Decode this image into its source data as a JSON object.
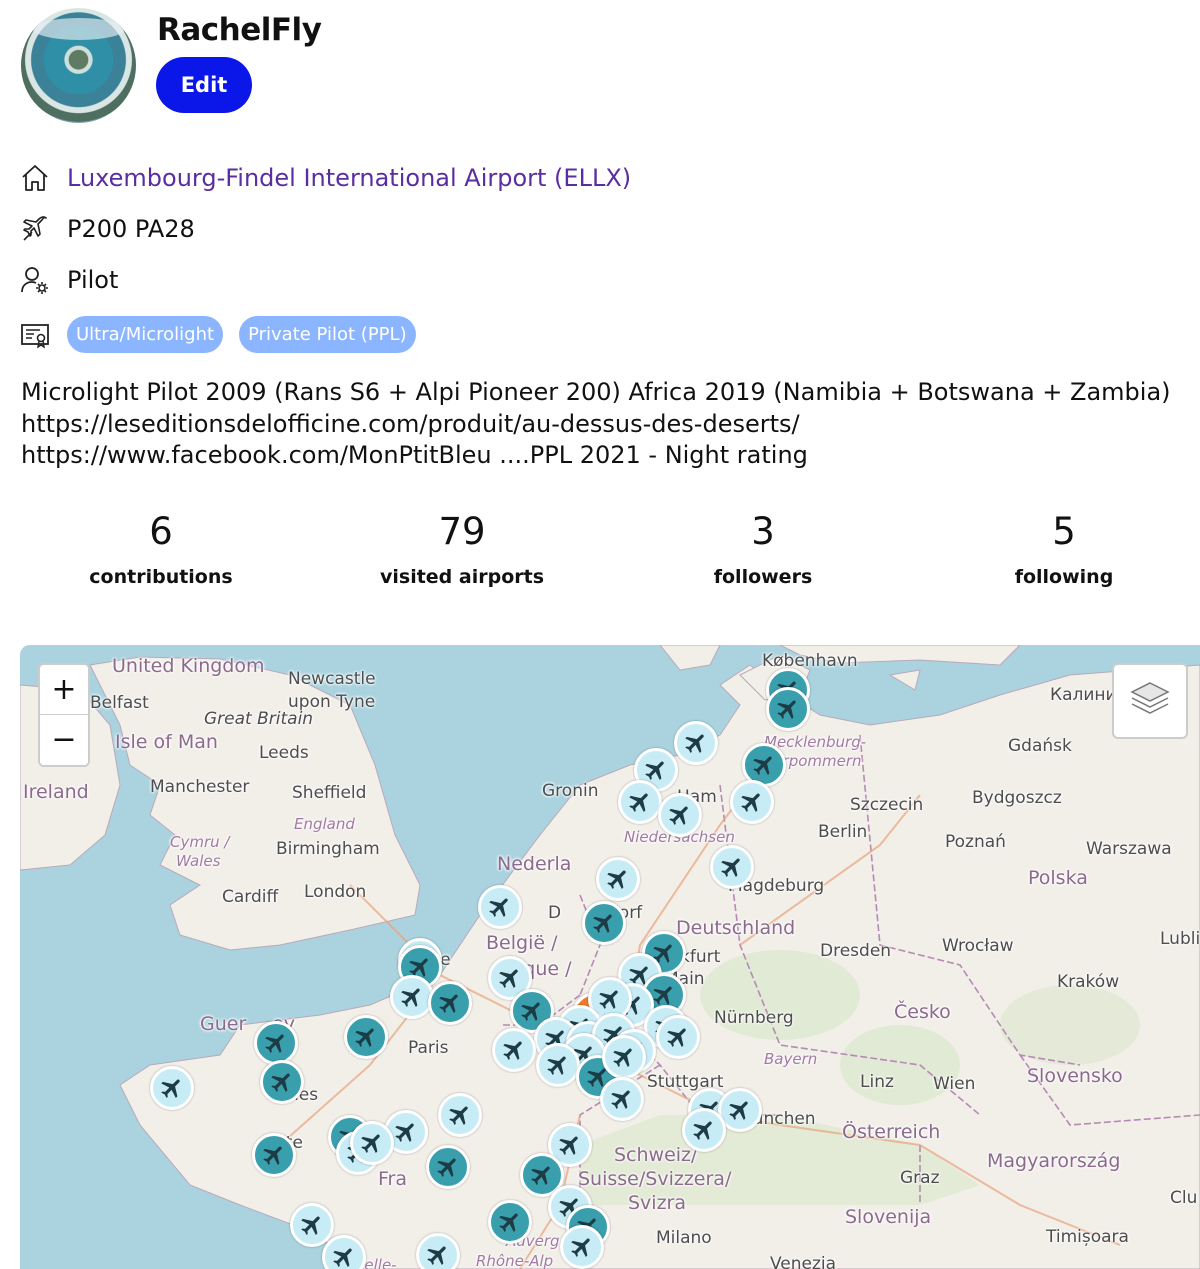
{
  "profile": {
    "username": "RachelFly",
    "edit_label": "Edit",
    "home_airport": "Luxembourg-Findel International Airport (ELLX)",
    "aircraft": "P200 PA28",
    "role": "Pilot",
    "licenses": [
      "Ultra/Microlight",
      "Private Pilot (PPL)"
    ],
    "bio": "Microlight Pilot 2009 (Rans S6 + Alpi Pioneer 200) Africa 2019 (Namibia + Botswana + Zambia) https://leseditionsdelofficine.com/produit/au-dessus-des-deserts/ https://www.facebook.com/MonPtitBleu ....PPL 2021 - Night rating"
  },
  "stats": [
    {
      "value": "6",
      "label": "contributions"
    },
    {
      "value": "79",
      "label": "visited airports"
    },
    {
      "value": "3",
      "label": "followers"
    },
    {
      "value": "5",
      "label": "following"
    }
  ],
  "map": {
    "zoom_in": "+",
    "zoom_out": "−",
    "layers_icon": "layers-icon",
    "colors": {
      "sea": "#aad3df",
      "land": "#f2efe9",
      "visited_marker": "#3a9fad",
      "planned_marker": "#c7ecf6",
      "home_marker": "#f07b2e"
    },
    "places": {
      "uk": "United Kingdom",
      "belfast": "Belfast",
      "newcastle1": "Newcastle",
      "newcastle2": "upon Tyne",
      "greatbritain": "Great Britain",
      "isleofman": "Isle of Man",
      "leeds": "Leeds",
      "ireland": "Ireland",
      "manchester": "Manchester",
      "sheffield": "Sheffield",
      "england": "England",
      "cymru": "Cymru /",
      "wales": "Wales",
      "birmingham": "Birmingham",
      "cardiff": "Cardiff",
      "london": "London",
      "kobenhavn": "København",
      "kalini": "Калини",
      "gdansk": "Gdańsk",
      "mecklenburg": "Mecklenburg-",
      "vorpommern": "Vorpommern",
      "szczecin": "Szczecin",
      "bydgoszcz": "Bydgoszcz",
      "groningen": "Gronin",
      "ham": "Ham",
      "niedersachsen": "Niedersachsen",
      "berlin": "Berlin",
      "poznan": "Poznań",
      "warszawa": "Warszawa",
      "nederland": "Nederla",
      "magdeburg": "Magdeburg",
      "polska": "Polska",
      "dusseldorf1": "D",
      "dusseldorf2": "dorf",
      "deutschland": "Deutschland",
      "belgie": "België /",
      "belgique": "ique /",
      "lille": "ille",
      "frankfurt": "kfurt",
      "main": "Main",
      "dresden": "Dresden",
      "wroclaw": "Wrocław",
      "lublin": "Lubli",
      "krakow": "Kraków",
      "ceska": "Česko",
      "nurnberg": "Nürnberg",
      "guernsey": "Guer",
      "guernsey2": "ey",
      "paris": "Paris",
      "bayern": "Bayern",
      "stuttgart": "Stuttgart",
      "linz": "Linz",
      "wien": "Wien",
      "slovensko": "Slovensko",
      "rennes": "nes",
      "munchen": "München",
      "osterreich": "Österreich",
      "nantes": "nte",
      "schweiz": "Schweiz/",
      "suisse": "Suisse/Svizzera/",
      "svizra": "Svizra",
      "magyar": "Magyarország",
      "france": "Fra",
      "graz": "Graz",
      "clu": "Clu",
      "slovenija": "Slovenija",
      "milano": "Milano",
      "timisoara": "Timișoara",
      "venezia": "Venezia",
      "auvergne": "Auverg",
      "rhone": "Rhône-Alp",
      "nouvelle": "uvelle-"
    }
  }
}
